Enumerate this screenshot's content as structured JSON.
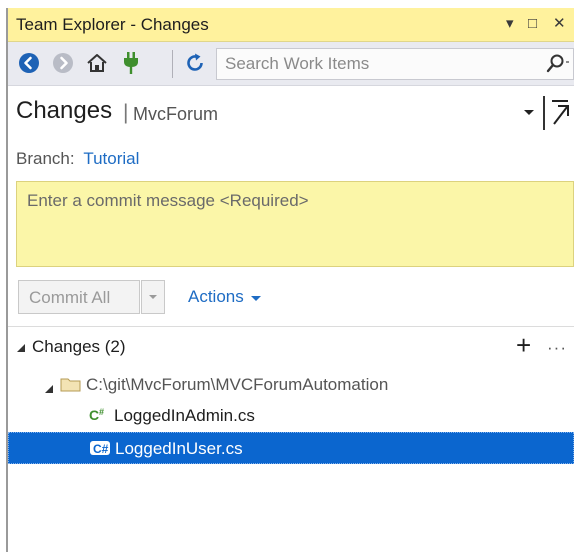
{
  "window": {
    "title": "Team Explorer - Changes",
    "controls": {
      "dropdown": "▾",
      "maximize": "□",
      "close": "✕"
    }
  },
  "toolbar": {
    "icons": [
      "back-icon",
      "forward-icon",
      "home-icon",
      "connect-icon",
      "refresh-icon"
    ],
    "search_placeholder": "Search Work Items",
    "search_value": ""
  },
  "header": {
    "title": "Changes",
    "separator": "|",
    "repo": "MvcForum"
  },
  "branch": {
    "label": "Branch:",
    "name": "Tutorial"
  },
  "commit": {
    "placeholder": "Enter a commit message <Required>",
    "button_label": "Commit All",
    "actions_label": "Actions"
  },
  "changes": {
    "header": "Changes (2)",
    "plus": "+",
    "more": "···",
    "folder_path": "C:\\git\\MvcForum\\MVCForumAutomation",
    "files": [
      {
        "name": "LoggedInAdmin.cs",
        "selected": false
      },
      {
        "name": "LoggedInUser.cs",
        "selected": true
      }
    ]
  },
  "colors": {
    "title_bar": "#fff29d",
    "commit_box": "#fbf6a8",
    "link": "#1e6cc4",
    "selection": "#0b66cf",
    "csharp_icon": "#3f8f2e"
  }
}
